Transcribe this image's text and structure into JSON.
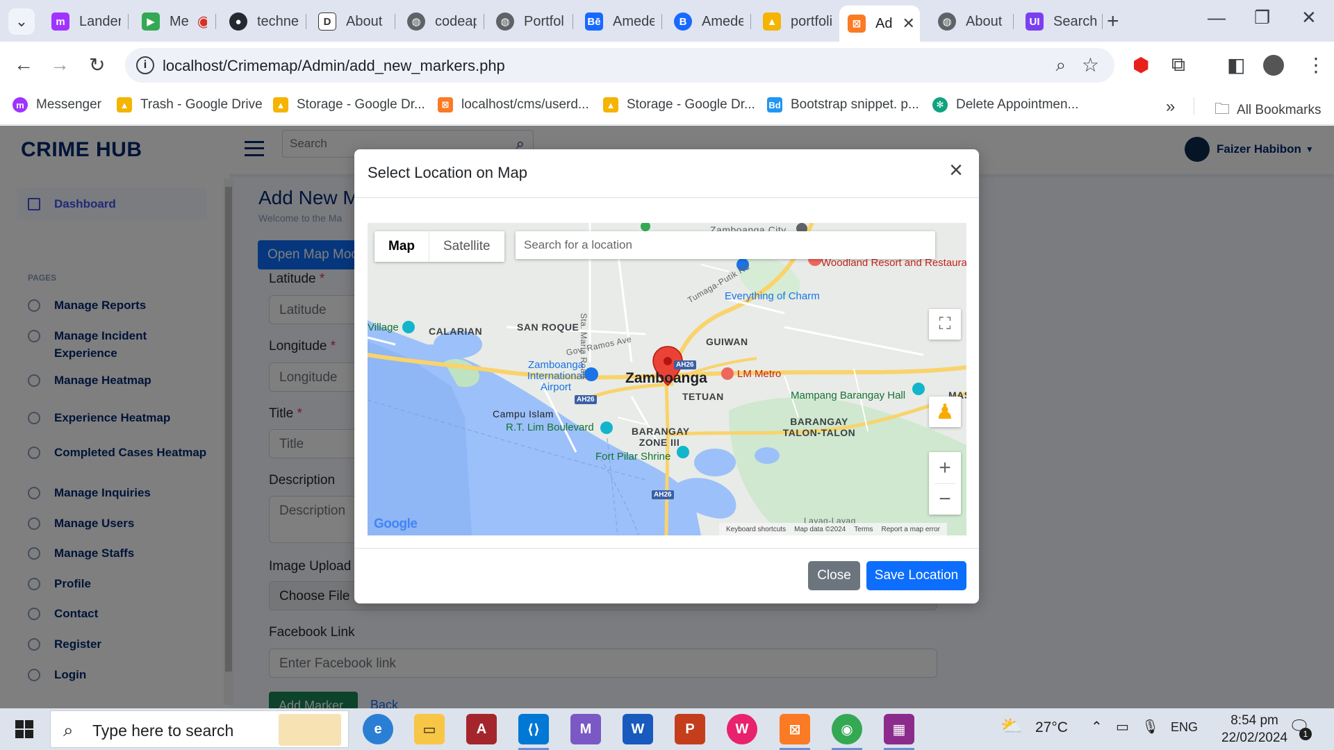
{
  "browser": {
    "tabs": [
      {
        "label": "Lander",
        "icon": "messenger-icon",
        "color": "#a033ff"
      },
      {
        "label": "Me",
        "icon": "meet-icon",
        "color": "#34a853"
      },
      {
        "label": "techne",
        "icon": "github-icon",
        "color": "#24292f"
      },
      {
        "label": "About",
        "icon": "d-icon",
        "color": "#333333"
      },
      {
        "label": "codeap",
        "icon": "globe-icon",
        "color": "#5f6368"
      },
      {
        "label": "Portfoli",
        "icon": "globe-icon",
        "color": "#5f6368"
      },
      {
        "label": "Amede",
        "icon": "behance-icon",
        "color": "#1769ff"
      },
      {
        "label": "Amede",
        "icon": "behance-circle-icon",
        "color": "#1769ff"
      },
      {
        "label": "portfoli",
        "icon": "drive-icon",
        "color": "#f4b400"
      },
      {
        "label": "Ad",
        "icon": "xampp-icon",
        "color": "#fb7a24",
        "active": true
      },
      {
        "label": "About",
        "icon": "globe-icon",
        "color": "#5f6368"
      },
      {
        "label": "Search",
        "icon": "ui-icon",
        "color": "#7b3ff2"
      }
    ],
    "url": "localhost/Crimemap/Admin/add_new_markers.php",
    "bookmarks": [
      {
        "label": "Messenger",
        "color": "#a033ff"
      },
      {
        "label": "Trash - Google Drive",
        "color": "#f4b400"
      },
      {
        "label": "Storage - Google Dr...",
        "color": "#f4b400"
      },
      {
        "label": "localhost/cms/userd...",
        "color": "#fb7a24"
      },
      {
        "label": "Storage - Google Dr...",
        "color": "#f4b400"
      },
      {
        "label": "Bootstrap snippet. p...",
        "color": "#2196f3"
      },
      {
        "label": "Delete Appointmen...",
        "color": "#10a37f"
      }
    ],
    "all_bookmarks": "All Bookmarks"
  },
  "app": {
    "brand": "CRIME HUB",
    "search_placeholder": "Search",
    "user": "Faizer Habibon",
    "sidebar": {
      "dashboard": "Dashboard",
      "pages_heading": "PAGES",
      "items": [
        "Manage Reports",
        "Manage Incident Experience",
        "Manage Heatmap",
        "Experience Heatmap",
        "Completed Cases Heatmap",
        "Manage Inquiries",
        "Manage Users",
        "Manage Staffs",
        "Profile",
        "Contact",
        "Register",
        "Login"
      ]
    },
    "main": {
      "title": "Add New M",
      "subtitle": "Welcome to the Ma",
      "open_map_button": "Open Map Moc",
      "latitude_label": "Latitude",
      "latitude_placeholder": "Latitude",
      "longitude_label": "Longitude",
      "longitude_placeholder": "Longitude",
      "title_label": "Title",
      "title_placeholder": "Title",
      "description_label": "Description",
      "description_placeholder": "Description",
      "image_label": "Image Upload",
      "choose_file": "Choose File",
      "facebook_label": "Facebook Link",
      "facebook_placeholder": "Enter Facebook link",
      "add_marker": "Add Marker",
      "back": "Back",
      "required_mark": "*"
    }
  },
  "modal": {
    "title": "Select Location on Map",
    "close_button": "Close",
    "save_button": "Save Location",
    "map": {
      "map_tab": "Map",
      "satellite_tab": "Satellite",
      "search_placeholder": "Search for a location",
      "labels": {
        "zamboanga_city": "Zamboanga City",
        "woodland": "Woodland Resort and Restaurant",
        "charm": "Everything of Charm",
        "calarian": "CALARIAN",
        "san_roque": "SAN ROQUE",
        "guiwan": "GUIWAN",
        "gov_ramos": "Gov. Ramos Ave",
        "sta_maria": "Sta. Maria Road",
        "tumaga": "Tumaga-Putik Rd",
        "village": "Village",
        "airport": "Zamboanga International Airport",
        "zamboanga": "Zamboanga",
        "lm_metro": "LM Metro",
        "tetuan": "TETUAN",
        "mampang": "Mampang Barangay Hall",
        "mas": "MAS",
        "campu_islam": "Campu Islam",
        "rt_lim": "R.T. Lim Boulevard",
        "barangay_zone": "BARANGAY ZONE III",
        "barangay_talon": "BARANGAY TALON-TALON",
        "fort_pilar": "Fort Pilar Shrine",
        "layag": "Layag-Layag",
        "ah26": "AH26"
      },
      "attribution": [
        "Keyboard shortcuts",
        "Map data ©2024",
        "Terms",
        "Report a map error"
      ],
      "logo": "Google"
    }
  },
  "taskbar": {
    "search_placeholder": "Type here to search",
    "temperature": "27°C",
    "language": "ENG",
    "time": "8:54 pm",
    "date": "22/02/2024",
    "notification_count": "1"
  }
}
